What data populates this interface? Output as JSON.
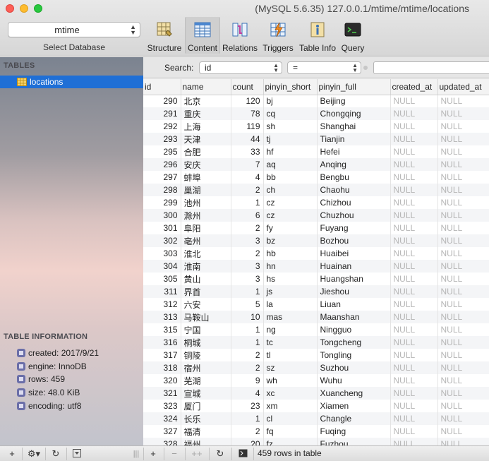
{
  "window": {
    "title": "(MySQL 5.6.35) 127.0.0.1/mtime/mtime/locations"
  },
  "database_select": {
    "value": "mtime",
    "label": "Select Database"
  },
  "toolbar": [
    {
      "label": "Structure",
      "icon": "structure-icon"
    },
    {
      "label": "Content",
      "icon": "content-icon",
      "active": true
    },
    {
      "label": "Relations",
      "icon": "relations-icon"
    },
    {
      "label": "Triggers",
      "icon": "triggers-icon"
    },
    {
      "label": "Table Info",
      "icon": "table-info-icon"
    },
    {
      "label": "Query",
      "icon": "query-icon"
    }
  ],
  "sidebar": {
    "tables_heading": "TABLES",
    "tables": [
      {
        "name": "locations",
        "selected": true
      }
    ],
    "info_heading": "TABLE INFORMATION",
    "info": [
      "created: 2017/9/21",
      "engine: InnoDB",
      "rows: 459",
      "size: 48.0 KiB",
      "encoding: utf8"
    ]
  },
  "search": {
    "label": "Search:",
    "field": "id",
    "operator": "=",
    "value": ""
  },
  "table": {
    "columns": [
      "id",
      "name",
      "count",
      "pinyin_short",
      "pinyin_full",
      "created_at",
      "updated_at"
    ],
    "rows": [
      [
        "290",
        "北京",
        "120",
        "bj",
        "Beijing",
        "NULL",
        "NULL"
      ],
      [
        "291",
        "重庆",
        "78",
        "cq",
        "Chongqing",
        "NULL",
        "NULL"
      ],
      [
        "292",
        "上海",
        "119",
        "sh",
        "Shanghai",
        "NULL",
        "NULL"
      ],
      [
        "293",
        "天津",
        "44",
        "tj",
        "Tianjin",
        "NULL",
        "NULL"
      ],
      [
        "295",
        "合肥",
        "33",
        "hf",
        "Hefei",
        "NULL",
        "NULL"
      ],
      [
        "296",
        "安庆",
        "7",
        "aq",
        "Anqing",
        "NULL",
        "NULL"
      ],
      [
        "297",
        "蚌埠",
        "4",
        "bb",
        "Bengbu",
        "NULL",
        "NULL"
      ],
      [
        "298",
        "巢湖",
        "2",
        "ch",
        "Chaohu",
        "NULL",
        "NULL"
      ],
      [
        "299",
        "池州",
        "1",
        "cz",
        "Chizhou",
        "NULL",
        "NULL"
      ],
      [
        "300",
        "滁州",
        "6",
        "cz",
        "Chuzhou",
        "NULL",
        "NULL"
      ],
      [
        "301",
        "阜阳",
        "2",
        "fy",
        "Fuyang",
        "NULL",
        "NULL"
      ],
      [
        "302",
        "亳州",
        "3",
        "bz",
        "Bozhou",
        "NULL",
        "NULL"
      ],
      [
        "303",
        "淮北",
        "2",
        "hb",
        "Huaibei",
        "NULL",
        "NULL"
      ],
      [
        "304",
        "淮南",
        "3",
        "hn",
        "Huainan",
        "NULL",
        "NULL"
      ],
      [
        "305",
        "黄山",
        "3",
        "hs",
        "Huangshan",
        "NULL",
        "NULL"
      ],
      [
        "311",
        "界首",
        "1",
        "js",
        "Jieshou",
        "NULL",
        "NULL"
      ],
      [
        "312",
        "六安",
        "5",
        "la",
        "Liuan",
        "NULL",
        "NULL"
      ],
      [
        "313",
        "马鞍山",
        "10",
        "mas",
        "Maanshan",
        "NULL",
        "NULL"
      ],
      [
        "315",
        "宁国",
        "1",
        "ng",
        "Ningguo",
        "NULL",
        "NULL"
      ],
      [
        "316",
        "桐城",
        "1",
        "tc",
        "Tongcheng",
        "NULL",
        "NULL"
      ],
      [
        "317",
        "铜陵",
        "2",
        "tl",
        "Tongling",
        "NULL",
        "NULL"
      ],
      [
        "318",
        "宿州",
        "2",
        "sz",
        "Suzhou",
        "NULL",
        "NULL"
      ],
      [
        "320",
        "芜湖",
        "9",
        "wh",
        "Wuhu",
        "NULL",
        "NULL"
      ],
      [
        "321",
        "宣城",
        "4",
        "xc",
        "Xuancheng",
        "NULL",
        "NULL"
      ],
      [
        "323",
        "厦门",
        "23",
        "xm",
        "Xiamen",
        "NULL",
        "NULL"
      ],
      [
        "324",
        "长乐",
        "1",
        "cl",
        "Changle",
        "NULL",
        "NULL"
      ],
      [
        "327",
        "福清",
        "2",
        "fq",
        "Fuqing",
        "NULL",
        "NULL"
      ],
      [
        "328",
        "福州",
        "20",
        "fz",
        "Fuzhou",
        "NULL",
        "NULL"
      ]
    ]
  },
  "bottombar": {
    "status": "459 rows in table",
    "left_icons": [
      "add-icon",
      "gear-icon",
      "refresh-icon",
      "filter-icon"
    ],
    "right_icons": [
      "column-resize-icon",
      "add-row-icon",
      "remove-row-icon",
      "duplicate-row-icon",
      "refresh-icon",
      "console-icon"
    ]
  },
  "colors": {
    "selection": "#1f6fd6",
    "null_text": "#b5b5b5"
  }
}
